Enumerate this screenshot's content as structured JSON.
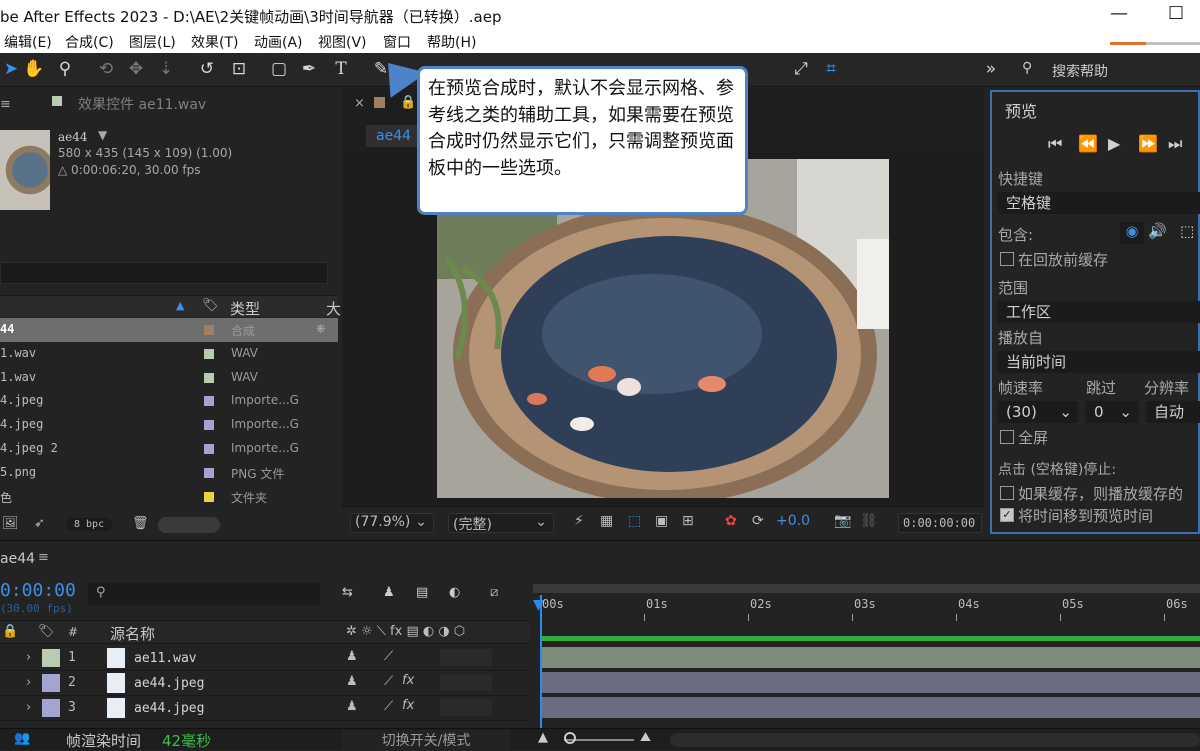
{
  "window": {
    "title": "be After Effects 2023 - D:\\AE\\2关键帧动画\\3时间导航器（已转换）.aep",
    "minimize": "—",
    "maximize": "☐"
  },
  "menu": [
    "编辑(E)",
    "合成(C)",
    "图层(L)",
    "效果(T)",
    "动画(A)",
    "视图(V)",
    "窗口",
    "帮助(H)"
  ],
  "toolbar": {
    "search_help": "搜索帮助"
  },
  "callout": {
    "text": "在预览合成时，默认不会显示网格、参考线之类的辅助工具，如果需要在预览合成时仍然显示它们，只需调整预览面板中的一些选项。"
  },
  "project": {
    "effect_tab": "效果控件 ae11.wav",
    "item_name": "ae44",
    "item_size": "580 x 435  (145 x 109) (1.00)",
    "item_duration": "△ 0:00:06:20, 30.00 fps",
    "col_type": "类型",
    "col_size_trunc": "大",
    "rows": [
      {
        "name": "44",
        "type": "合成",
        "color": "#a08060"
      },
      {
        "name": "1.wav",
        "type": "WAV",
        "color": "#b9ccb1"
      },
      {
        "name": "1.wav",
        "type": "WAV",
        "color": "#b9ccb1"
      },
      {
        "name": "4.jpeg",
        "type": "Importe...G",
        "color": "#a4a4d0"
      },
      {
        "name": "4.jpeg",
        "type": "Importe...G",
        "color": "#a4a4d0"
      },
      {
        "name": "4.jpeg 2",
        "type": "Importe...G",
        "color": "#a4a4d0"
      },
      {
        "name": "5.png",
        "type": "PNG 文件",
        "color": "#a4a4d0"
      },
      {
        "name": "色",
        "type": "文件夹",
        "color": "#e8d43c"
      }
    ],
    "bpc": "8 bpc"
  },
  "composition": {
    "tab_name": "ae44",
    "zoom": "(77.9%)",
    "resolution": "(完整)",
    "exposure": "+0.0",
    "timecode": "0:00:00:00"
  },
  "preview": {
    "title": "预览",
    "shortcut_label": "快捷键",
    "shortcut_value": "空格键",
    "include_label": "包含:",
    "cache_before": "在回放前缓存",
    "range_label": "范围",
    "range_value": "工作区",
    "play_from_label": "播放自",
    "play_from_value": "当前时间",
    "fps_label": "帧速率",
    "skip_label": "跳过",
    "res_label": "分辨率",
    "fps_value": "(30)",
    "skip_value": "0",
    "res_value": "自动",
    "fullscreen": "全屏",
    "stop_label": "点击 (空格键)停止:",
    "if_cached": "如果缓存，则播放缓存的",
    "move_time": "将时间移到预览时间"
  },
  "timeline": {
    "tab": "ae44",
    "timecode": "0:00:00",
    "fps": "(30.00 fps)",
    "col_source": "源名称",
    "col_num": "#",
    "rulers": [
      "00s",
      "01s",
      "02s",
      "03s",
      "04s",
      "05s",
      "06s"
    ],
    "layers": [
      {
        "num": "1",
        "name": "ae11.wav",
        "color": "#b9ccb1",
        "bar_color": "#7f8c7c",
        "fx": ""
      },
      {
        "num": "2",
        "name": "ae44.jpeg",
        "color": "#a4a4d0",
        "bar_color": "#6c6c80",
        "fx": "fx"
      },
      {
        "num": "3",
        "name": "ae44.jpeg",
        "color": "#a4a4d0",
        "bar_color": "#6c6c80",
        "fx": "fx"
      }
    ],
    "render_label": "帧渲染时间",
    "render_value": "42毫秒",
    "toggle_label": "切换开关/模式"
  }
}
